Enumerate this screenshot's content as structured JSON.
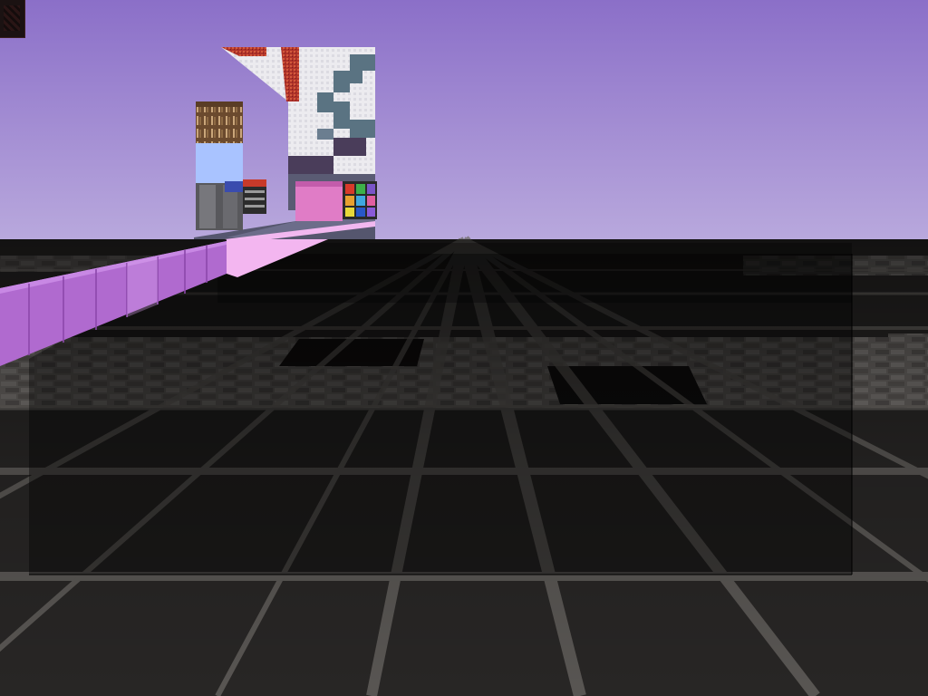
{
  "scene": {
    "kind": "voxel-sandbox-first-person-view",
    "sky_color_top": "#8d72c9",
    "sky_color_horizon": "#b8a8dc",
    "floor_color": "#2a2828",
    "floor_grid_color": "#6e6a66",
    "stone_strip_color": "#6a6663",
    "glass_block_color": "#b06ad0",
    "glass_highlight_color": "#f2b4f0",
    "pink_block_color": "#e67cc8",
    "blue_block_color": "#a8c4ff",
    "selection_overlay_color": "#000000"
  },
  "hud": {
    "thumbnail_icon": "block-thumbnail-icon"
  },
  "blocks": [
    "bookshelf-block",
    "light-blue-block",
    "iron-block",
    "tnt-block",
    "red-granite-block",
    "white-pattern-wall",
    "pink-block",
    "color-grid-block",
    "purple-glass-row"
  ]
}
